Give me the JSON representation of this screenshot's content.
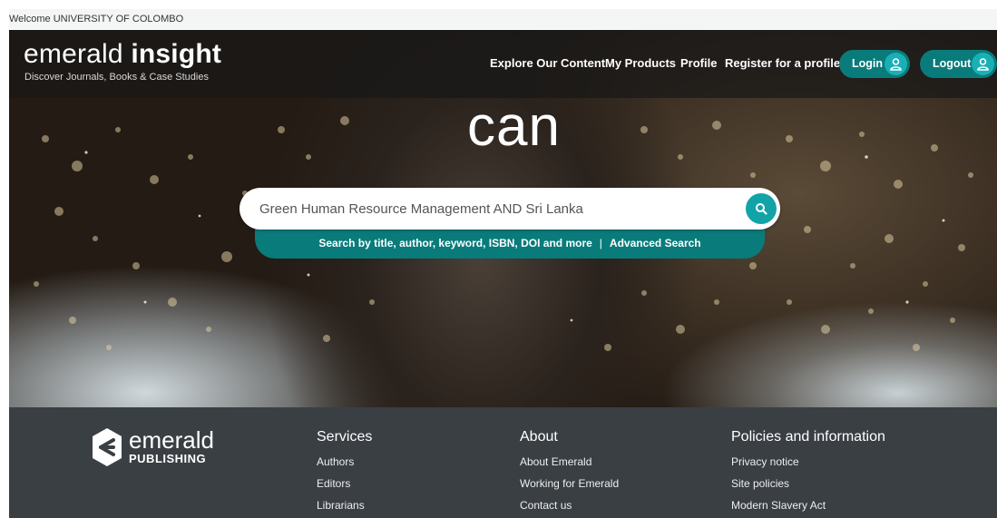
{
  "welcome": "Welcome UNIVERSITY OF COLOMBO",
  "brand": {
    "light": "emerald",
    "bold": "insight",
    "tagline": "Discover Journals, Books & Case Studies"
  },
  "nav": [
    {
      "label": "Explore Our Content"
    },
    {
      "label": "My Products"
    },
    {
      "label": "Profile"
    },
    {
      "label": "Register for a profile"
    }
  ],
  "auth": {
    "login": "Login",
    "logout": "Logout"
  },
  "hero_word": "can",
  "search": {
    "value": "Green Human Resource Management AND Sri Lanka",
    "hint": "Search by title, author, keyword, ISBN, DOI and more",
    "separator": "|",
    "advanced": "Advanced Search"
  },
  "footer": {
    "logo": {
      "name": "emerald",
      "sub": "PUBLISHING"
    },
    "columns": [
      {
        "title": "Services",
        "links": [
          "Authors",
          "Editors",
          "Librarians"
        ]
      },
      {
        "title": "About",
        "links": [
          "About Emerald",
          "Working for Emerald",
          "Contact us"
        ]
      },
      {
        "title": "Policies and information",
        "links": [
          "Privacy notice",
          "Site policies",
          "Modern Slavery Act"
        ]
      }
    ]
  },
  "colors": {
    "teal": "#0a7b7b",
    "teal_light": "#19b0b5",
    "footer_bg": "#3a3f44"
  },
  "icons": {
    "user": "user-icon",
    "search": "search-icon",
    "logo": "emerald-logo-icon"
  }
}
